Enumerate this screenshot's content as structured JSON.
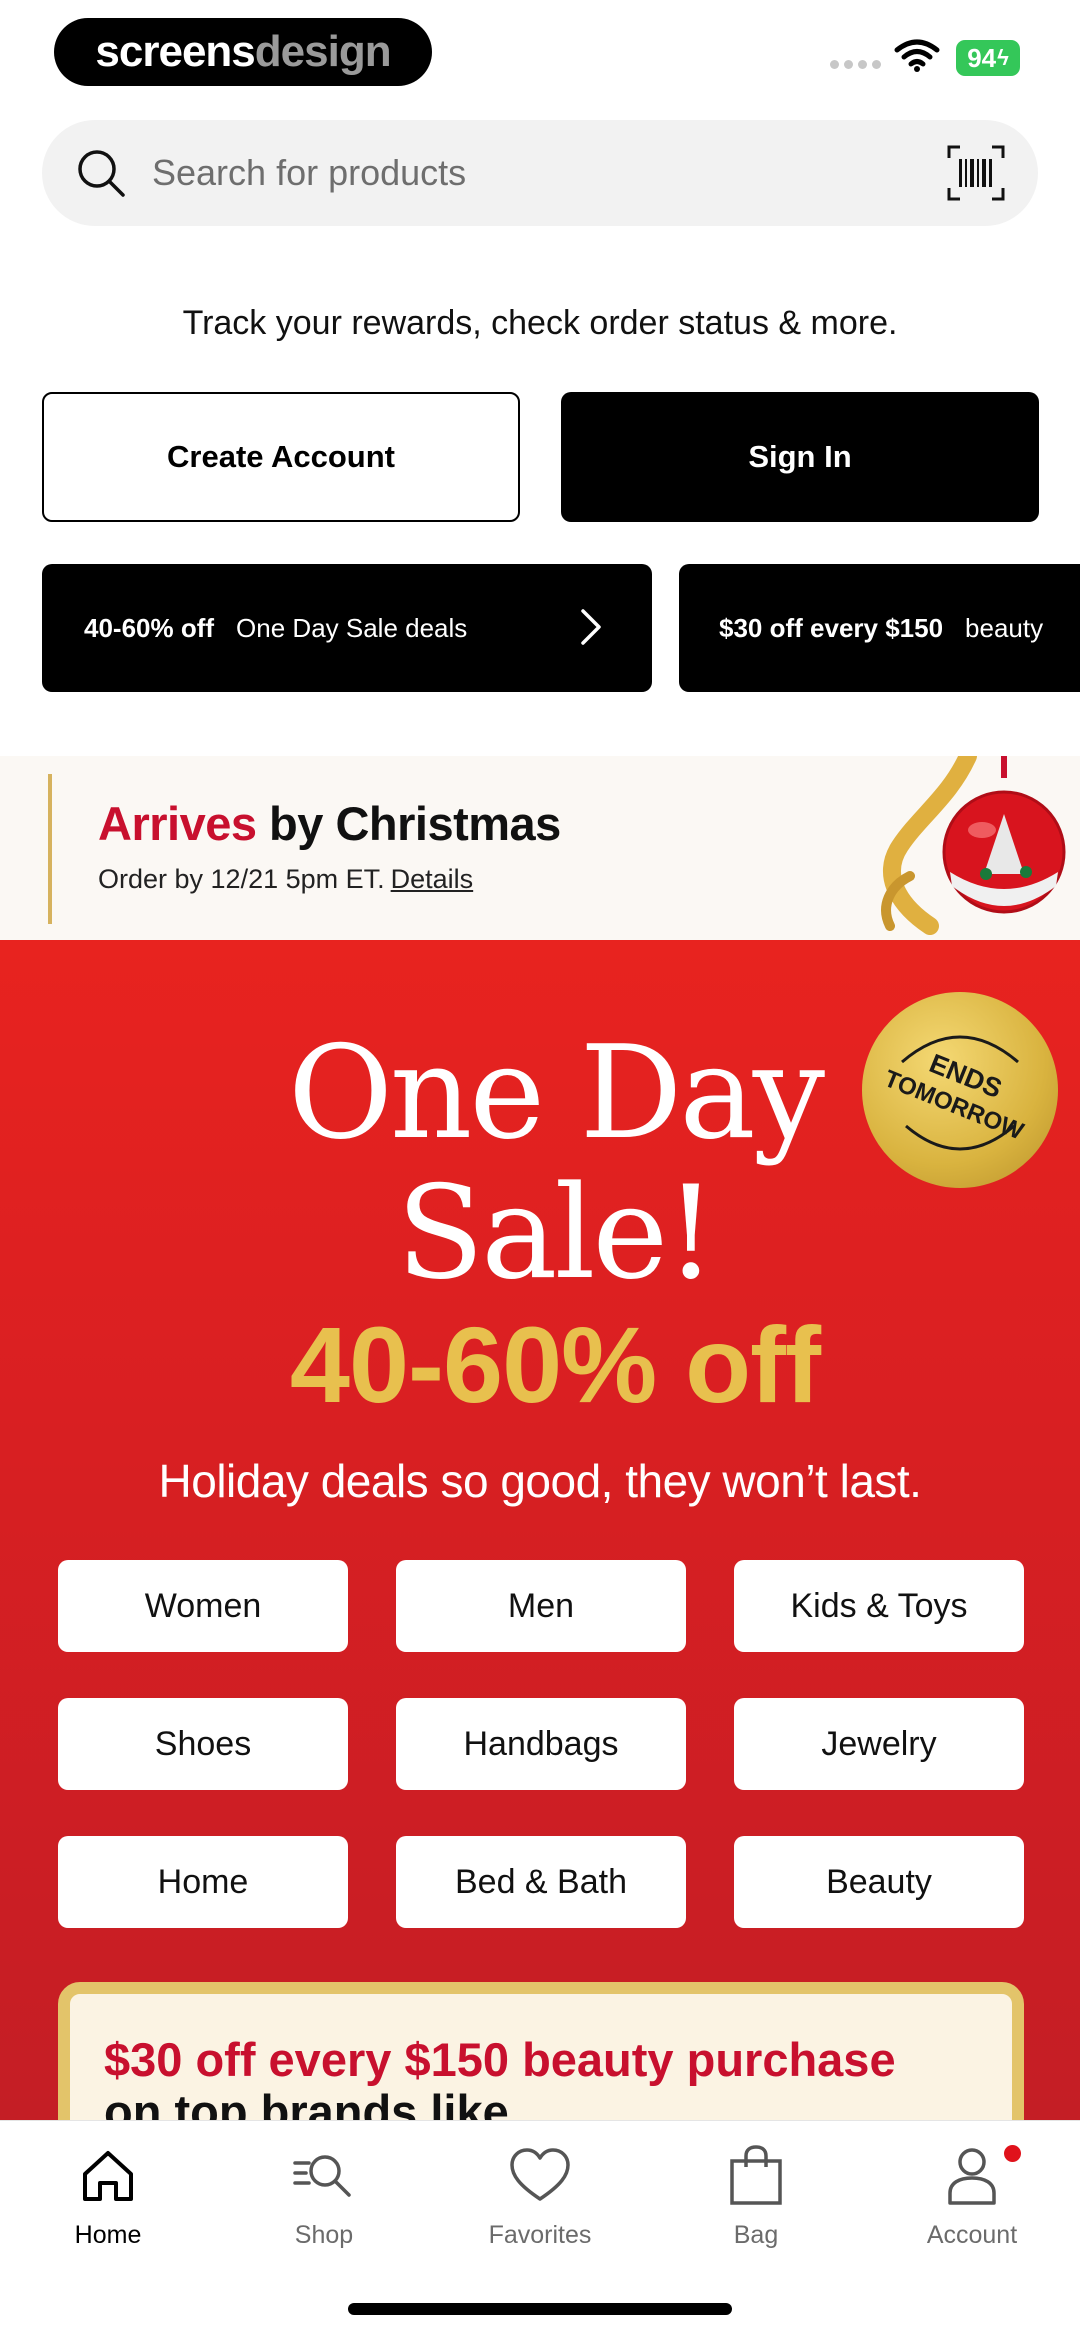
{
  "status_bar": {
    "brand_part1": "screens",
    "brand_part2": "design",
    "battery": "94"
  },
  "search": {
    "placeholder": "Search for products",
    "icon": "search-icon",
    "barcode_icon": "barcode-scan-icon"
  },
  "account_prompt": {
    "tagline": "Track your rewards, check order status & more.",
    "create_label": "Create Account",
    "signin_label": "Sign In"
  },
  "promos": [
    {
      "bold": "40-60% off",
      "text": "One Day Sale deals"
    },
    {
      "bold": "$30 off every $150",
      "text": "beauty"
    }
  ],
  "arrives": {
    "title_red": "Arrives",
    "title_rest": " by Christmas",
    "subtitle": "Order by 12/21 5pm ET.",
    "link": "Details"
  },
  "sale": {
    "title_line1": "One Day",
    "title_line2": "Sale!",
    "percent": "40-60% off",
    "subtitle": "Holiday deals so good, they won’t last.",
    "badge_line1": "ENDS",
    "badge_line2": "TOMORROW",
    "categories": [
      "Women",
      "Men",
      "Kids & Toys",
      "Shoes",
      "Handbags",
      "Jewelry",
      "Home",
      "Bed & Bath",
      "Beauty"
    ],
    "beauty_red": "$30 off every $150 beauty purchase",
    "beauty_dark": " on top brands like"
  },
  "colors": {
    "sale_red": "#d91f22",
    "gold": "#e8c04e",
    "brand_red": "#c8102e",
    "black": "#000000"
  },
  "tabs": [
    {
      "label": "Home",
      "icon": "home-icon",
      "active": true
    },
    {
      "label": "Shop",
      "icon": "shop-search-icon",
      "active": false
    },
    {
      "label": "Favorites",
      "icon": "heart-icon",
      "active": false
    },
    {
      "label": "Bag",
      "icon": "bag-icon",
      "active": false
    },
    {
      "label": "Account",
      "icon": "account-icon",
      "active": false
    }
  ]
}
